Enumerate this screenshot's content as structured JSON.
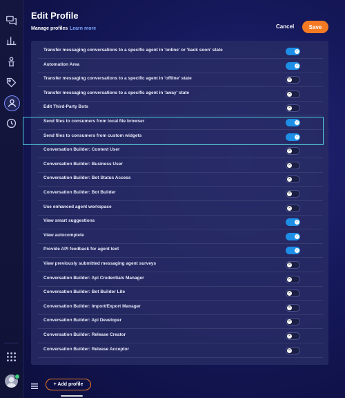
{
  "header": {
    "title": "Edit Profile",
    "subtitle": "Manage profiles",
    "learn_more": "Learn more",
    "cancel": "Cancel",
    "save": "Save"
  },
  "sidebar": {
    "icons": [
      "chat-icon",
      "analytics-icon",
      "campaign-icon",
      "tag-icon",
      "users-icon",
      "automation-icon",
      "apps-grid-icon",
      "avatar"
    ]
  },
  "rows": [
    {
      "label": "Transfer messaging conversations to a specific agent in 'online' or 'back soon' state",
      "on": true
    },
    {
      "label": "Automation Area",
      "on": true
    },
    {
      "label": "Transfer messaging conversations to a specific agent in 'offline' state",
      "on": false
    },
    {
      "label": "Transfer messaging conversations to a specific agent in 'away' state",
      "on": false
    },
    {
      "label": "Edit Third-Party Bots",
      "on": false
    },
    {
      "label": "Send files to consumers from local file browser",
      "on": true
    },
    {
      "label": "Send files to consumers from custom widgets",
      "on": true
    },
    {
      "label": "Conversation Builder: Content User",
      "on": false
    },
    {
      "label": "Conversation Builder: Business User",
      "on": false
    },
    {
      "label": "Conversation Builder: Bot Status Access",
      "on": false
    },
    {
      "label": "Conversation Builder: Bot Builder",
      "on": false
    },
    {
      "label": "Use enhanced agent workspace",
      "on": false
    },
    {
      "label": "View smart suggestions",
      "on": true
    },
    {
      "label": "View autocomplete",
      "on": true
    },
    {
      "label": "Provide API feedback for agent text",
      "on": true
    },
    {
      "label": "View previously submitted messaging agent surveys",
      "on": false
    },
    {
      "label": "Conversation Builder: Api Credentials Manager",
      "on": false
    },
    {
      "label": "Conversation Builder: Bot Builder Lite",
      "on": false
    },
    {
      "label": "Conversation Builder: Import/Export Manager",
      "on": false
    },
    {
      "label": "Conversation Builder: Api Developer",
      "on": false
    },
    {
      "label": "Conversation Builder: Release Creator",
      "on": false
    },
    {
      "label": "Conversation Builder: Release Acceptor",
      "on": false
    }
  ],
  "footer": {
    "add_profile": "+ Add profile"
  }
}
